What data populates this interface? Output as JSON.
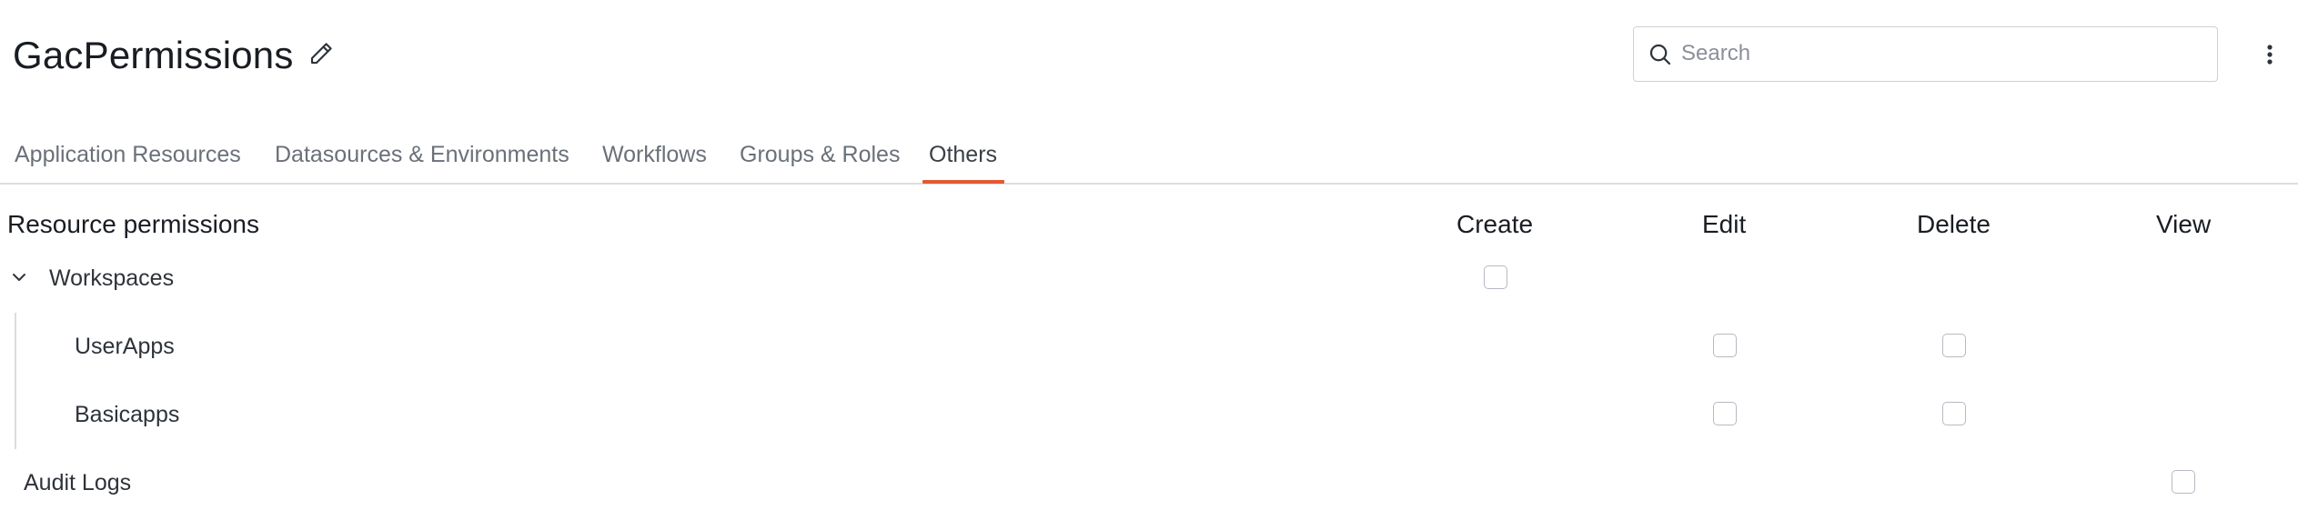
{
  "header": {
    "title": "GacPermissions",
    "edit_icon": "pencil-icon",
    "search": {
      "placeholder": "Search",
      "value": ""
    },
    "more_icon": "vertical-ellipsis-icon"
  },
  "tabs": [
    {
      "label": "Application Resources",
      "active": false
    },
    {
      "label": "Datasources & Environments",
      "active": false
    },
    {
      "label": "Workflows",
      "active": false
    },
    {
      "label": "Groups & Roles",
      "active": false
    },
    {
      "label": "Others",
      "active": true
    }
  ],
  "accent_color": "#e15a32",
  "permissions": {
    "section_title": "Resource permissions",
    "columns": [
      "Create",
      "Edit",
      "Delete",
      "View"
    ],
    "rows": [
      {
        "label": "Workspaces",
        "expanded": true,
        "checkboxes": {
          "Create": false
        }
      },
      {
        "label": "UserApps",
        "child_of": "Workspaces",
        "checkboxes": {
          "Edit": false,
          "Delete": false
        }
      },
      {
        "label": "Basicapps",
        "child_of": "Workspaces",
        "checkboxes": {
          "Edit": false,
          "Delete": false
        }
      },
      {
        "label": "Audit Logs",
        "checkboxes": {
          "View": false
        }
      }
    ]
  }
}
